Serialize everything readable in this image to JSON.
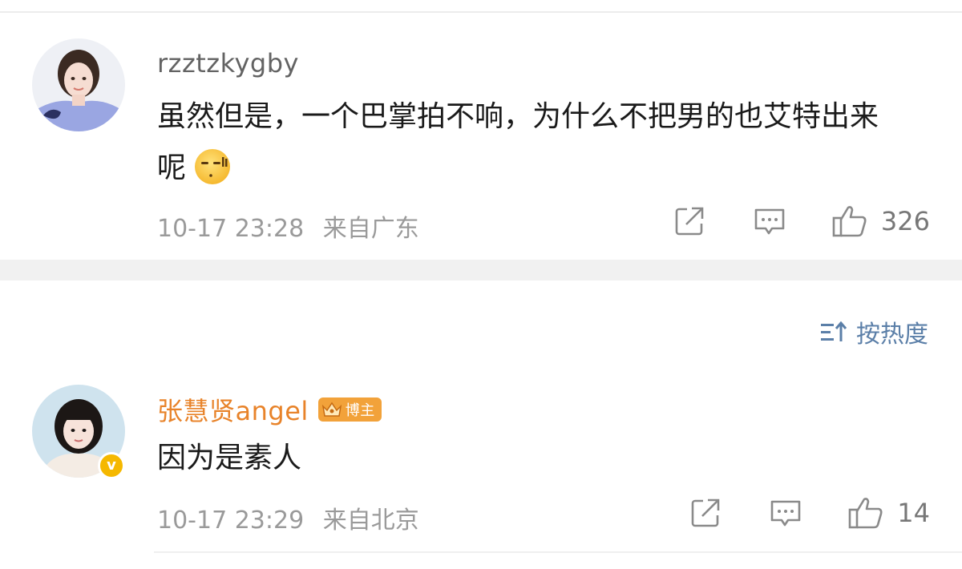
{
  "comments": [
    {
      "username": "rzztzkygby",
      "text": "虽然但是，一个巴掌拍不响，为什么不把男的也艾特出来呢",
      "emoji_icon": "awkward-sweat-emoji",
      "date": "10-17 23:28",
      "location": "来自广东",
      "likes": "326"
    },
    {
      "username": "张慧贤angel",
      "badge": "博主",
      "verified": true,
      "text": "因为是素人",
      "date": "10-17 23:29",
      "location": "来自北京",
      "likes": "14"
    }
  ],
  "sort": {
    "label": "按热度",
    "icon": "sort-icon"
  },
  "icons": [
    "share-icon",
    "reply-icon",
    "like-icon",
    "verified-icon",
    "crown-icon"
  ],
  "colors": {
    "username_gray": "#636363",
    "author_orange": "#e8832a",
    "badge_orange": "#f2a23a",
    "verified_yellow": "#f5b800",
    "sort_blue": "#5b7fa8",
    "meta_gray": "#9a9a9a"
  }
}
